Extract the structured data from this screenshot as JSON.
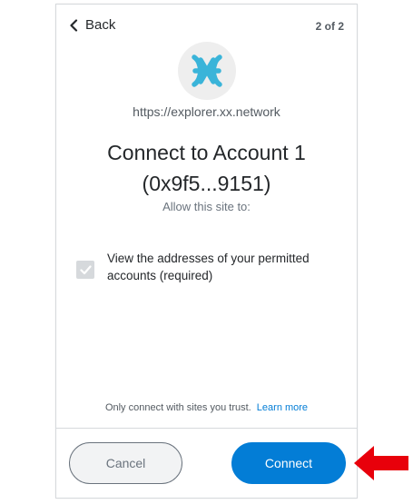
{
  "header": {
    "back_label": "Back",
    "step": "2 of 2"
  },
  "site": {
    "origin": "https://explorer.xx.network",
    "icon": "xx-network-logo-icon"
  },
  "connect": {
    "title_line1": "Connect to Account 1",
    "title_line2": "(0x9f5...9151)",
    "subtitle": "Allow this site to:"
  },
  "permissions": [
    {
      "label": "View the addresses of your permitted accounts (required)",
      "checked": true
    }
  ],
  "footer": {
    "note": "Only connect with sites you trust.",
    "learn_more": "Learn more"
  },
  "buttons": {
    "cancel": "Cancel",
    "connect": "Connect"
  },
  "colors": {
    "primary": "#037dd6",
    "annotation_arrow": "#e8000b",
    "logo": "#3ab4d9"
  }
}
